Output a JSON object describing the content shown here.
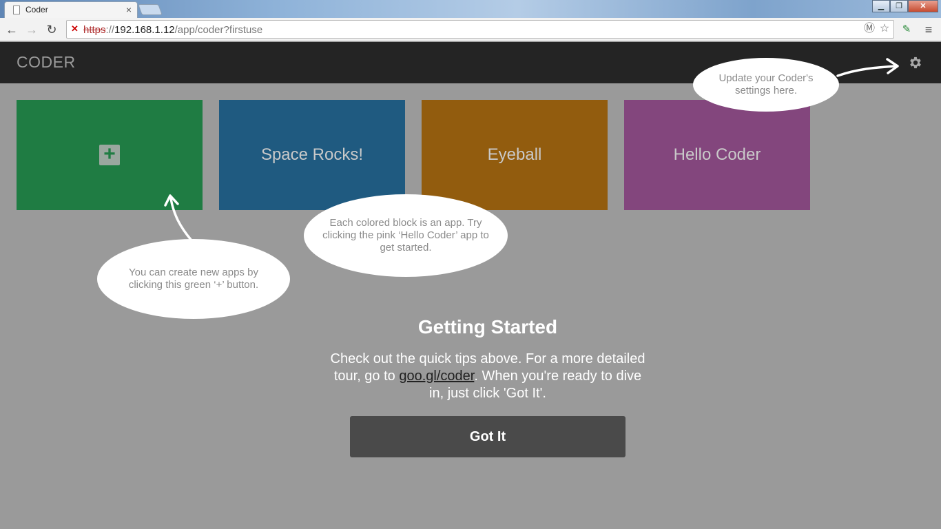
{
  "browser": {
    "tab_title": "Coder",
    "tab_close": "×",
    "url_protocol": "https",
    "url_sep": "://",
    "url_host": "192.168.1.12",
    "url_path": "/app/coder?firstuse",
    "window_buttons": {
      "minimize": "▁",
      "maximize": "❐",
      "close": "✕"
    }
  },
  "header": {
    "title": "CODER"
  },
  "tiles": [
    {
      "label": "+",
      "color": "#1f7c43"
    },
    {
      "label": "Space Rocks!",
      "color": "#1f5a80"
    },
    {
      "label": "Eyeball",
      "color": "#925c0e"
    },
    {
      "label": "Hello Coder",
      "color": "#83467d"
    }
  ],
  "callouts": {
    "settings": "Update your Coder's settings here.",
    "apps": "Each colored block is an app. Try clicking the pink ‘Hello Coder’ app to get started.",
    "create": "You can create new apps by clicking this green ‘+’ button."
  },
  "getting_started": {
    "title": "Getting Started",
    "text_before": "Check out the quick tips above. For a more detailed tour, go to ",
    "link": "goo.gl/coder",
    "text_after": ". When you're ready to dive in, just click 'Got It'.",
    "button": "Got It"
  }
}
